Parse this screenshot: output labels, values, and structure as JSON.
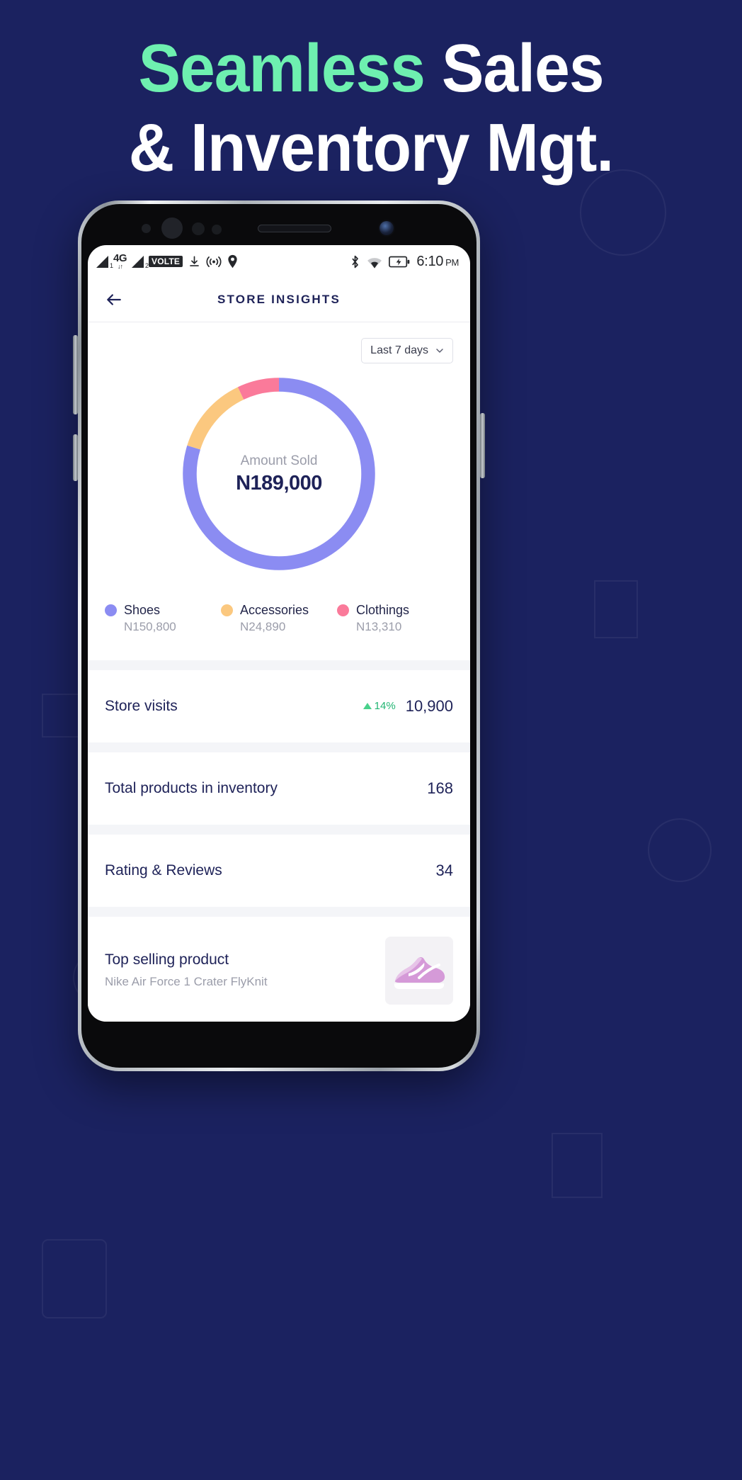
{
  "banner": {
    "line1_accent": "Seamless",
    "line1_rest": " Sales",
    "line2": "& Inventory Mgt.",
    "bg_color": "#1b2260",
    "accent_color": "#6ef0b0"
  },
  "statusbar": {
    "sim1_label": "1",
    "network": "4G",
    "network_arrows": "↓↑",
    "sim2_label": "2",
    "volte": "VOLTE",
    "icons": [
      "signal-1-icon",
      "4g-icon",
      "signal-2-icon",
      "volte-badge",
      "download-icon",
      "cast-icon",
      "location-pin-icon",
      "bluetooth-icon",
      "wifi-icon",
      "battery-charging-icon"
    ],
    "time": "6:10",
    "meridiem": "PM"
  },
  "appbar": {
    "back_icon": "back-arrow-icon",
    "title": "STORE INSIGHTS"
  },
  "filter": {
    "label": "Last 7 days",
    "chevron": "chevron-down-icon"
  },
  "chart_data": {
    "type": "pie",
    "title": "Amount Sold",
    "center_label": "Amount Sold",
    "center_value": "N189,000",
    "total": 189000,
    "currency_symbol": "N",
    "legend_position": "bottom",
    "categories": [
      "Shoes",
      "Accessories",
      "Clothings"
    ],
    "values": [
      150800,
      24890,
      13310
    ],
    "value_labels": [
      "N150,800",
      "N24,890",
      "N13,310"
    ],
    "percentages": [
      79.8,
      13.2,
      7.0
    ],
    "colors": [
      "#8b8cf2",
      "#fbc87f",
      "#fa7a9a"
    ],
    "hole_ratio": 0.82,
    "start_angle": -90
  },
  "legend": [
    {
      "name": "Shoes",
      "amount": "N150,800",
      "color": "#8b8cf2"
    },
    {
      "name": "Accessories",
      "amount": "N24,890",
      "color": "#fbc87f"
    },
    {
      "name": "Clothings",
      "amount": "N13,310",
      "color": "#fa7a9a"
    }
  ],
  "stats": [
    {
      "label": "Store visits",
      "delta": "14%",
      "delta_direction": "up",
      "delta_color": "#22b573",
      "value": "10,900"
    },
    {
      "label": "Total products in inventory",
      "delta": "",
      "value": "168"
    },
    {
      "label": "Rating & Reviews",
      "delta": "",
      "value": "34"
    }
  ],
  "top_product": {
    "title": "Top selling product",
    "name": "Nike Air Force 1 Crater FlyKnit",
    "thumb_icon": "sneaker-thumbnail"
  }
}
